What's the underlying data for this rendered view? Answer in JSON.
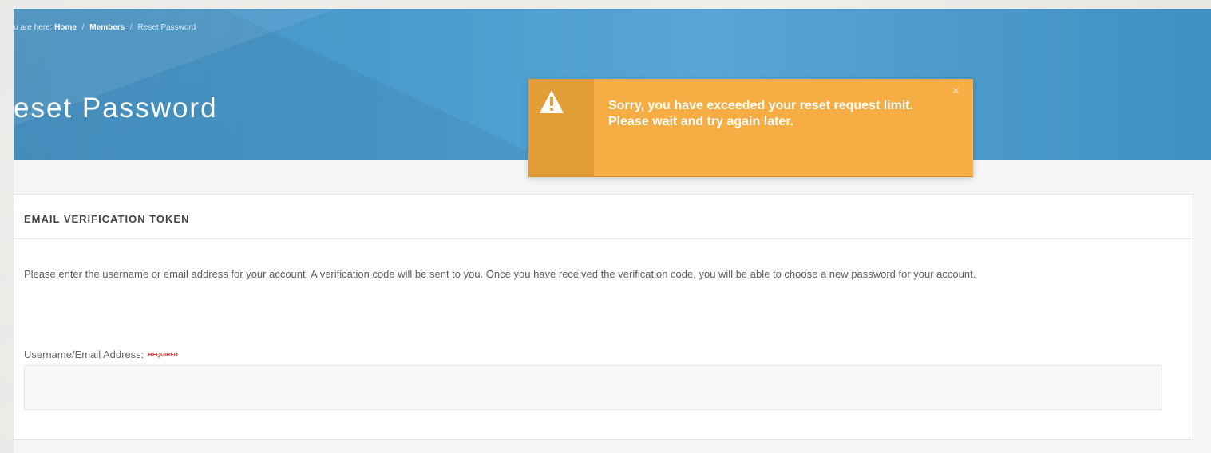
{
  "breadcrumb": {
    "prefix": "u are here:",
    "items": [
      "Home",
      "Members",
      "Reset Password"
    ],
    "separator": "/"
  },
  "page": {
    "title": "eset Password"
  },
  "alert": {
    "icon": "warning-icon",
    "message": "Sorry, you have exceeded your reset request limit. Please wait and try again later.",
    "close": "×",
    "colors": {
      "background": "#f6ad43",
      "iconbox": "#e39d36"
    }
  },
  "panel": {
    "title": "EMAIL VERIFICATION TOKEN",
    "description": "Please enter the username or email address for your account. A verification code will be sent to you. Once you have received the verification code, you will be able to choose a new password for your account.",
    "field": {
      "label": "Username/Email Address:",
      "required": "REQUIRED",
      "value": "",
      "placeholder": ""
    }
  },
  "colors": {
    "banner_blue": "#4c9ccf",
    "required_red": "#d8232a"
  }
}
